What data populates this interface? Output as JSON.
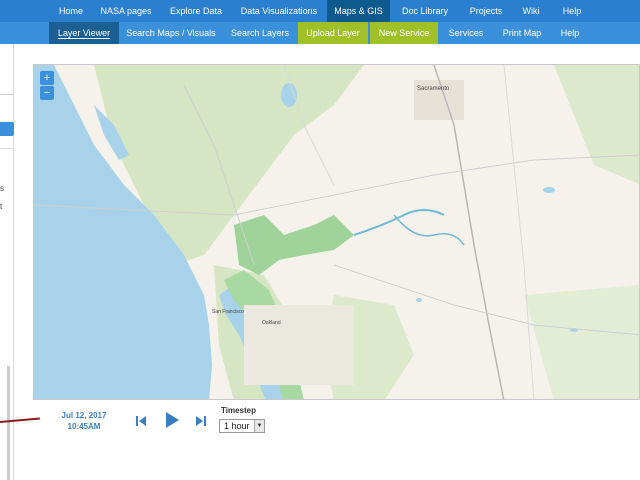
{
  "top_nav": {
    "items": [
      {
        "label": "Home"
      },
      {
        "label": "NASA pages"
      },
      {
        "label": "Explore Data"
      },
      {
        "label": "Data Visualizations"
      },
      {
        "label": "Maps & GIS",
        "active": true
      },
      {
        "label": "Doc Library"
      },
      {
        "label": "Projects"
      },
      {
        "label": "Wiki"
      },
      {
        "label": "Help"
      }
    ]
  },
  "sub_nav": {
    "items": [
      {
        "label": "Layer Viewer",
        "active": true
      },
      {
        "label": "Search Maps / Visuals"
      },
      {
        "label": "Search Layers"
      },
      {
        "label": "Upload Layer",
        "highlight": true
      },
      {
        "label": "New Service",
        "highlight": true
      },
      {
        "label": "Services"
      },
      {
        "label": "Print Map"
      },
      {
        "label": "Help"
      }
    ]
  },
  "left_panel": {
    "fragments": [
      "s",
      "t"
    ]
  },
  "map": {
    "zoom_in": "+",
    "zoom_out": "−",
    "place_labels": [
      "Sacramento",
      "San Francisco",
      "Oakland"
    ],
    "colors": {
      "ocean": "#a7d2ea",
      "land": "#f4f2ea",
      "vegetation": "#c9e0b4",
      "wetland": "#9fd39a",
      "road": "#d9d9d9",
      "highway": "#b8b8b8"
    }
  },
  "time_controls": {
    "date": "Jul 12, 2017",
    "time": "10:45AM",
    "timestep_label": "Timestep",
    "timestep_value": "1 hour",
    "icons": [
      "skip-back-icon",
      "play-icon",
      "skip-forward-icon"
    ]
  },
  "colors": {
    "nav_bg": "#2a7fcf",
    "nav_active": "#0f5a8c",
    "subnav_bg": "#3a90da",
    "subnav_active": "#1b5f93",
    "subnav_highlight": "#9fc027",
    "accent": "#3a7fc2"
  }
}
